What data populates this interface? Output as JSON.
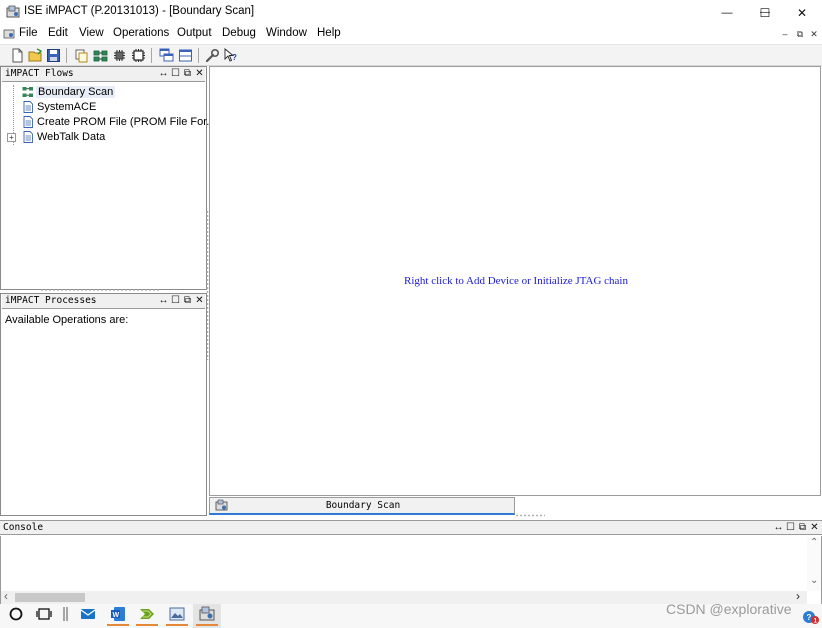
{
  "window": {
    "title": "ISE iMPACT (P.20131013) - [Boundary Scan]",
    "minimize_glyph": "—",
    "maximize_glyph": "☐",
    "close_glyph": "✕"
  },
  "menu": {
    "items": [
      "File",
      "Edit",
      "View",
      "Operations",
      "Output",
      "Debug",
      "Window",
      "Help"
    ],
    "mdi_controls": [
      "–",
      "⧉",
      "✕"
    ]
  },
  "toolbar": {
    "icons": [
      "new-file-icon",
      "open-folder-icon",
      "save-icon",
      "copy-icon",
      "jtag-chain-icon",
      "debug-chip-icon",
      "device-icon",
      "cascade-windows-icon",
      "tile-windows-icon",
      "wrench-icon",
      "help-cursor-icon"
    ]
  },
  "flows_panel": {
    "title": "iMPACT Flows",
    "items": [
      {
        "label": "Boundary Scan",
        "icon": "boundary-scan-icon",
        "selected": true
      },
      {
        "label": "SystemACE",
        "icon": "document-icon",
        "selected": false
      },
      {
        "label": "Create PROM File (PROM File For...",
        "icon": "document-icon",
        "selected": false
      },
      {
        "label": "WebTalk Data",
        "icon": "document-icon",
        "selected": false,
        "expandable": true
      }
    ]
  },
  "processes_panel": {
    "title": "iMPACT Processes",
    "body_text": "Available Operations are:"
  },
  "canvas": {
    "message": "Right click to Add Device or Initialize JTAG chain"
  },
  "doc_tab": {
    "label": "Boundary Scan"
  },
  "console": {
    "title": "Console",
    "scroll_up": "⌃",
    "scroll_down": "⌄",
    "scroll_left": "‹",
    "scroll_right": "›"
  },
  "panel_controls": [
    "↔",
    "☐",
    "⧉",
    "✕"
  ],
  "taskbar": {
    "icons": [
      "start-circle-icon",
      "task-view-icon",
      "divider-icon",
      "mail-icon",
      "word-icon",
      "ise-project-icon",
      "image-viewer-icon",
      "impact-app-icon"
    ]
  },
  "watermark": "CSDN @explorative",
  "colors": {
    "canvas_message": "#1a1adb",
    "tab_accent": "#2f7bd3",
    "taskbar_underline": "#e38a3a"
  }
}
